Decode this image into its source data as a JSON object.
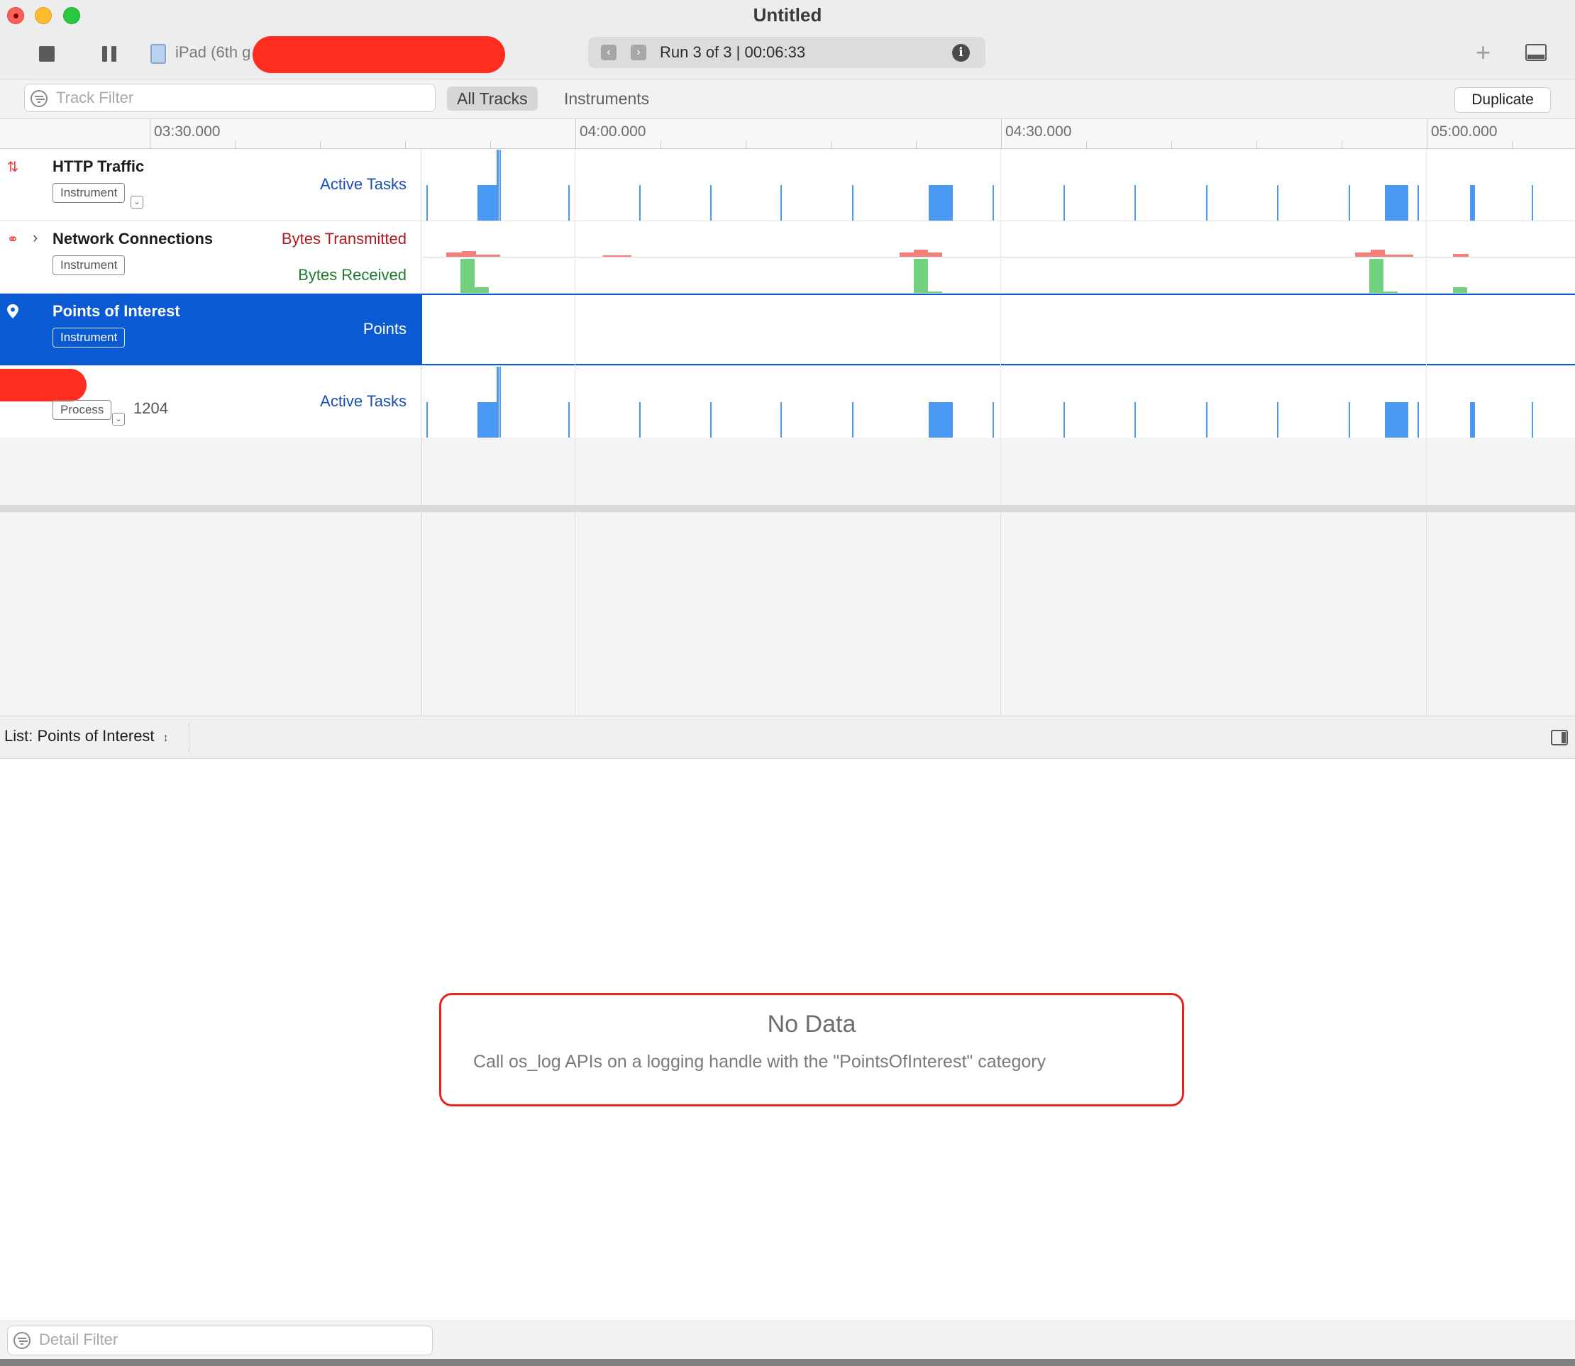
{
  "window": {
    "title": "Untitled"
  },
  "toolbar": {
    "device_label": "iPad (6th g",
    "run_label": "Run 3 of 3  |  00:06:33",
    "add_label": "+"
  },
  "filterbar": {
    "track_filter_placeholder": "Track Filter",
    "tab_all_tracks": "All Tracks",
    "tab_instruments": "Instruments",
    "duplicate_label": "Duplicate"
  },
  "ruler": {
    "labels": [
      "03:30.000",
      "04:00.000",
      "04:30.000",
      "05:00.000"
    ]
  },
  "tracks": [
    {
      "name": "HTTP Traffic",
      "badge": "Instrument",
      "meta": "Active Tasks",
      "icon": "arrows-up-down-icon"
    },
    {
      "name": "Network Connections",
      "badge": "Instrument",
      "meta_tx": "Bytes Transmitted",
      "meta_rx": "Bytes Received",
      "icon": "globe-icon"
    },
    {
      "name": "Points of Interest",
      "badge": "Instrument",
      "meta": "Points",
      "icon": "map-pin-icon",
      "selected": true
    },
    {
      "name": "",
      "badge": "Process",
      "pid": "1204",
      "meta": "Active Tasks"
    }
  ],
  "detail": {
    "list_selector": "List: Points of Interest",
    "no_data_title": "No Data",
    "no_data_message": "Call os_log APIs on a logging handle with the \"PointsOfInterest\" category",
    "detail_filter_placeholder": "Detail Filter"
  },
  "colors": {
    "accent": "#0a5bd3",
    "activity": "#4a9af4",
    "transmitted": "#f47f7a",
    "received": "#72d17f",
    "annotation": "#e8231a"
  }
}
